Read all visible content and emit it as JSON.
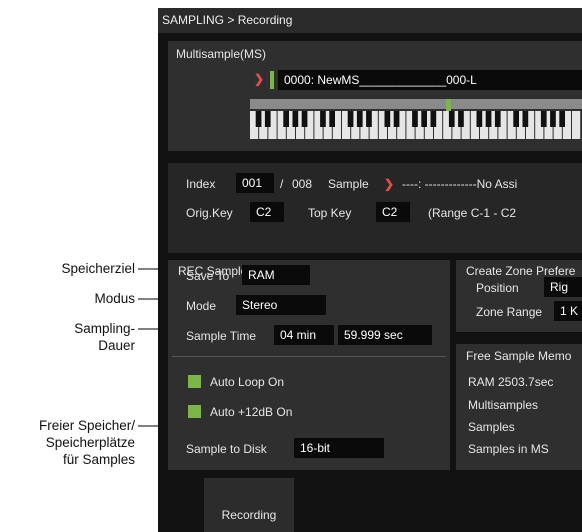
{
  "screen": {
    "breadcrumb": "SAMPLING > Recording",
    "multisample": {
      "section_title": "Multisample(MS)",
      "name": "0000: NewMS_____________000-L"
    },
    "sample_info": {
      "index_label": "Index",
      "index_value": "001",
      "index_sep": "/",
      "index_total": "008",
      "sample_label": "Sample",
      "sample_value": "----: -------------No Assi",
      "origkey_label": "Orig.Key",
      "origkey_value": "C2",
      "topkey_label": "Top Key",
      "topkey_value": "C2",
      "range_text": "(Range  C-1   -  C2"
    },
    "rec_setup": {
      "title": "REC Sample Setup",
      "save_to_label": "Save To",
      "save_to_value": "RAM",
      "mode_label": "Mode",
      "mode_value": "Stereo",
      "sample_time_label": "Sample Time",
      "sample_time_min": "04 min",
      "sample_time_sec": "59.999 sec",
      "auto_loop": "Auto Loop On",
      "auto_12db": "Auto +12dB On",
      "sample_to_disk_label": "Sample to Disk",
      "sample_to_disk_value": "16-bit"
    },
    "zone_prefs": {
      "title": "Create Zone Prefere",
      "position_label": "Position",
      "position_value": "Rig",
      "zone_range_label": "Zone Range",
      "zone_range_value": "1 K"
    },
    "free_memory": {
      "title": "Free Sample Memo",
      "ram_line": "RAM   2503.7sec",
      "multisamples": "Multisamples",
      "samples": "Samples",
      "samples_in_ms": "Samples in MS"
    },
    "tabs": [
      "Recording"
    ]
  },
  "callouts": {
    "speicherziel": "Speicherziel",
    "modus": "Modus",
    "sampling_l1": "Sampling-",
    "sampling_l2": "Dauer",
    "freier_l1": "Freier Speicher/",
    "freier_l2": "Speicherplätze",
    "freier_l3": "für Samples"
  },
  "colors": {
    "accent_green": "#7ab648",
    "chevron_red": "#e0504a",
    "background": "#121212",
    "panel": "#2f2f2f"
  }
}
